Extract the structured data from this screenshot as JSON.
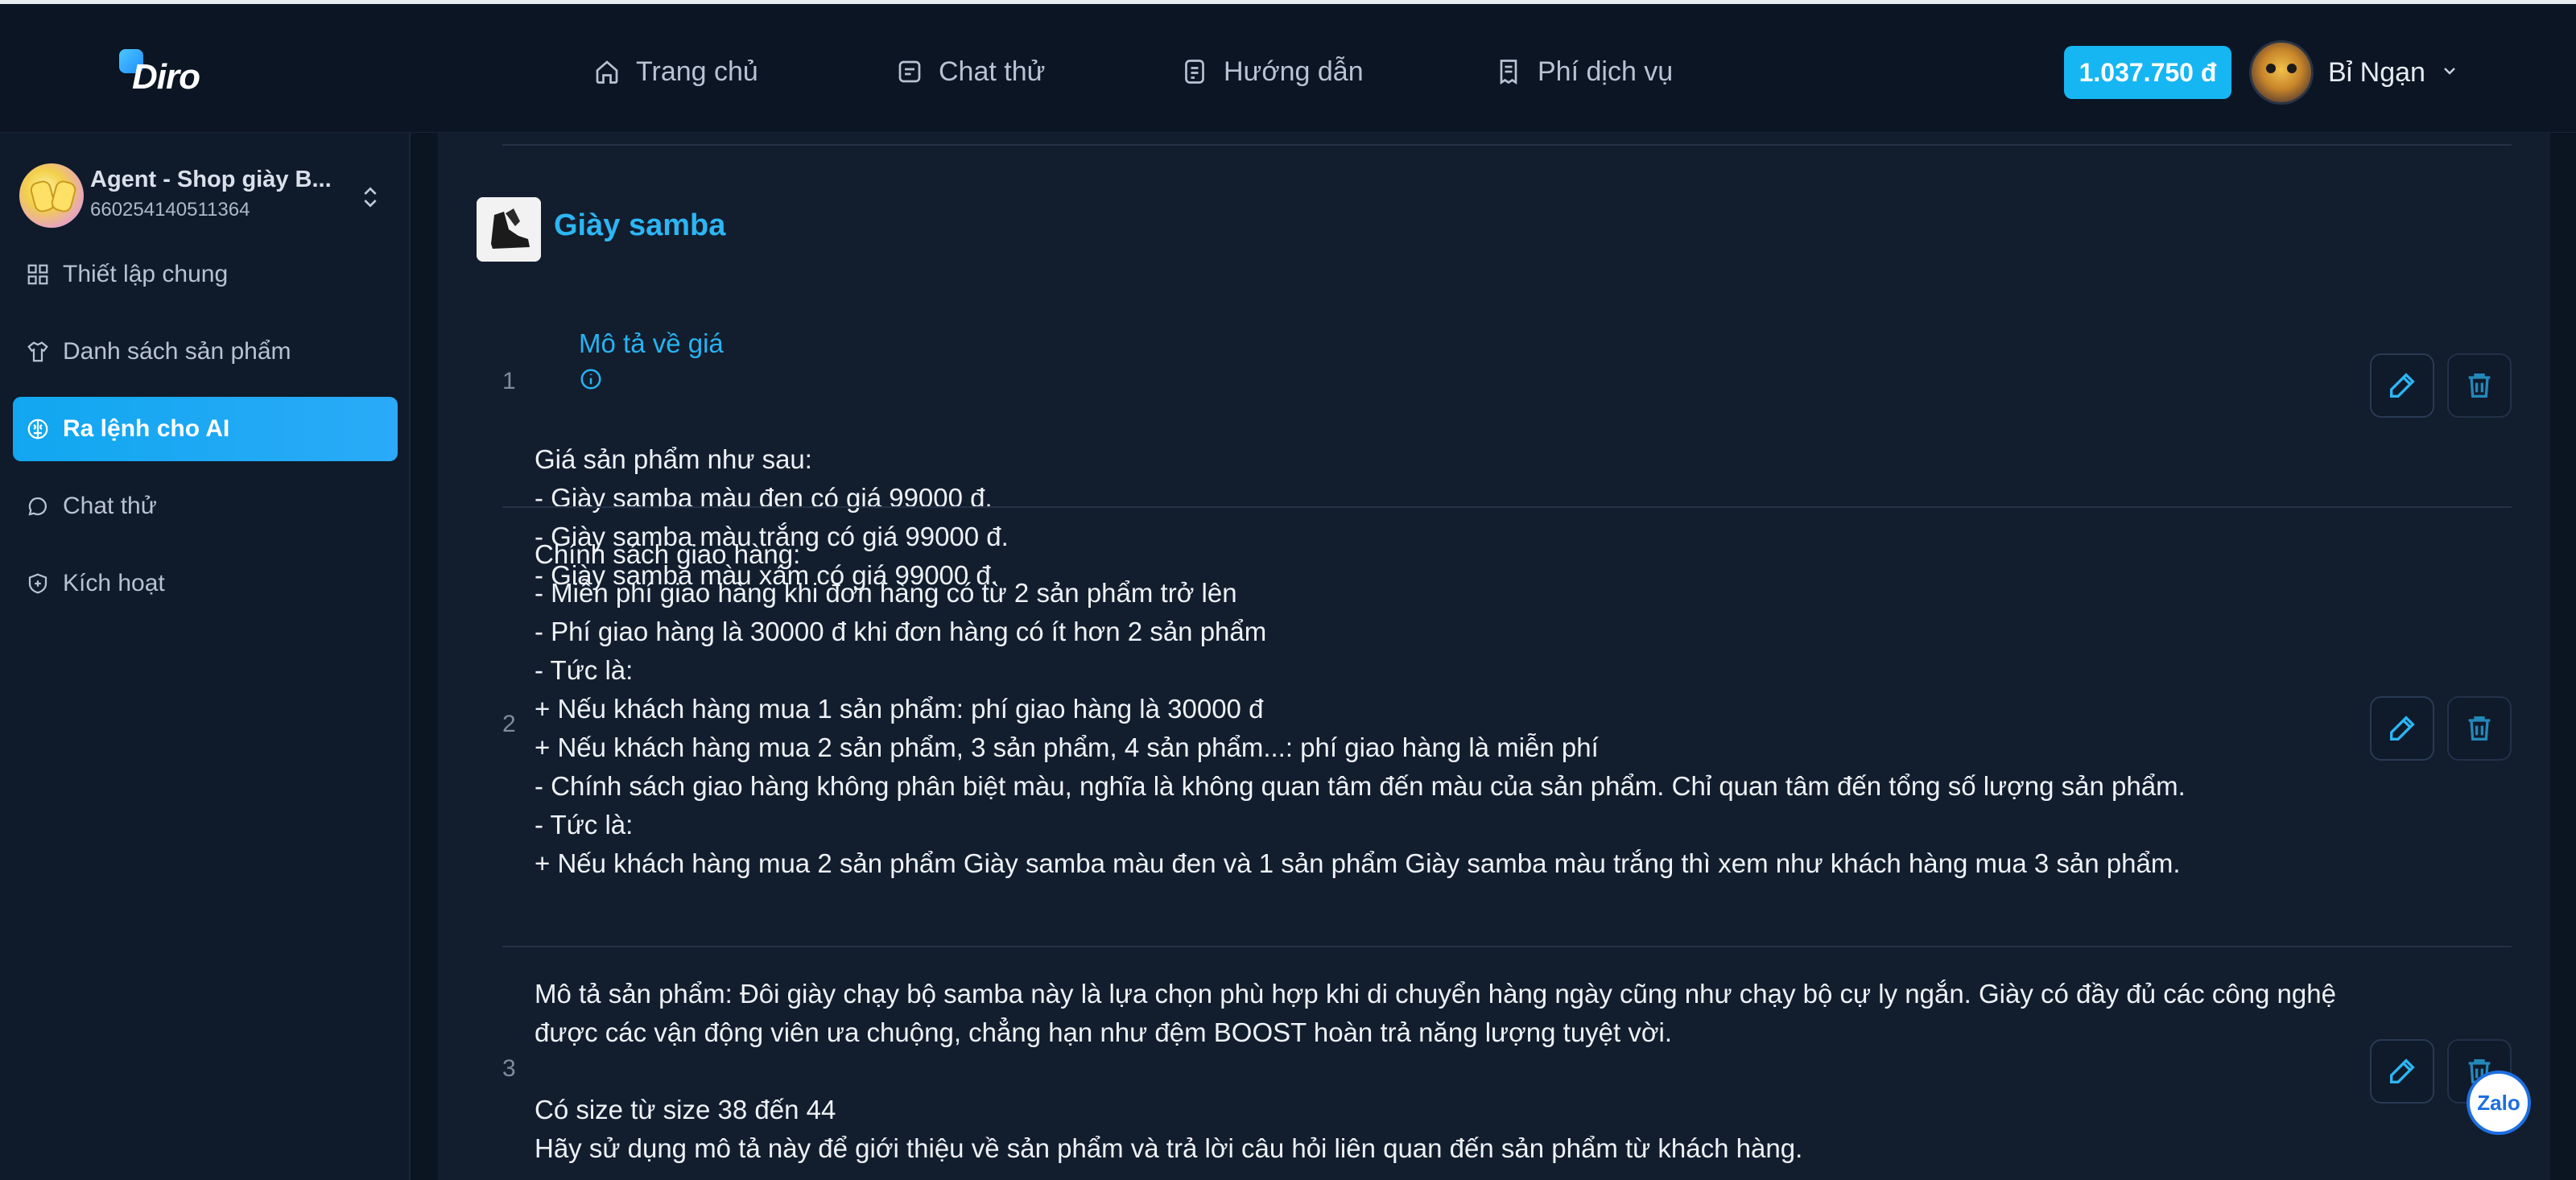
{
  "brand": {
    "logo_text": "Diro"
  },
  "nav": [
    {
      "label": "Trang chủ",
      "icon": "home-icon"
    },
    {
      "label": "Chat thử",
      "icon": "chat-icon"
    },
    {
      "label": "Hướng dẫn",
      "icon": "guide-icon"
    },
    {
      "label": "Phí dịch vụ",
      "icon": "receipt-icon"
    }
  ],
  "account": {
    "balance": "1.037.750 đ",
    "user_name": "Bỉ Ngạn"
  },
  "sidebar": {
    "agent_name": "Agent - Shop giày B...",
    "agent_id": "660254140511364",
    "items": [
      {
        "label": "Thiết lập chung",
        "icon": "grid-icon",
        "active": false
      },
      {
        "label": "Danh sách sản phẩm",
        "icon": "shirt-icon",
        "active": false
      },
      {
        "label": "Ra lệnh cho AI",
        "icon": "brain-icon",
        "active": true
      },
      {
        "label": "Chat thử",
        "icon": "chat-icon",
        "active": false
      },
      {
        "label": "Kích hoạt",
        "icon": "shield-icon",
        "active": false
      }
    ]
  },
  "product": {
    "title": "Giày samba",
    "price_label": "Mô tả về giá",
    "rows": [
      {
        "index": "1",
        "lines": [
          "Giá sản phẩm như sau:",
          "- Giày samba màu đen có giá 99000 đ.",
          "- Giày samba màu trắng có giá 99000 đ.",
          "- Giày samba màu xám có giá 99000 đ."
        ]
      },
      {
        "index": "2",
        "lines": [
          "Chính sách giao hàng:",
          "- Miễn phí giao hàng khi đơn hàng có từ 2 sản phẩm trở lên",
          "- Phí giao hàng là 30000 đ khi đơn hàng có ít hơn 2 sản phẩm",
          "- Tức là:",
          "+ Nếu khách hàng mua 1 sản phẩm: phí giao hàng là 30000 đ",
          "+ Nếu khách hàng mua 2 sản phẩm, 3 sản phẩm, 4 sản phẩm...: phí giao hàng là miễn phí",
          "- Chính sách giao hàng không phân biệt màu, nghĩa là không quan tâm đến màu của sản phẩm. Chỉ quan tâm đến tổng số lượng sản phẩm.",
          "- Tức là:",
          "+ Nếu khách hàng mua 2 sản phẩm Giày samba màu đen và 1 sản phẩm Giày samba màu trắng thì xem như khách hàng mua 3 sản phẩm."
        ]
      },
      {
        "index": "3",
        "lines": [
          "Mô tả sản phẩm: Đôi giày chạy bộ samba này là lựa chọn phù hợp khi di chuyển hàng ngày cũng như chạy bộ cự ly ngắn. Giày có đầy đủ các công nghệ được các vận động viên ưa chuộng, chẳng hạn như đệm BOOST hoàn trả năng lượng tuyệt vời.",
          "",
          "Có size từ size 38 đến 44",
          "Hãy sử dụng mô tả này để giới thiệu về sản phẩm và trả lời câu hỏi liên quan đến sản phẩm từ khách hàng."
        ]
      }
    ]
  },
  "chat_widget": {
    "label": "Zalo"
  },
  "colors": {
    "accent": "#16b6f2",
    "background": "#0b1421",
    "panel": "#121d2e"
  }
}
